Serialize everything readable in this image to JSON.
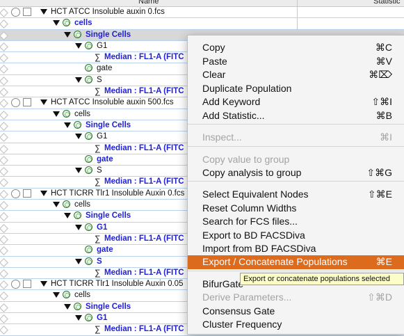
{
  "header": {
    "name": "Name",
    "statistic": "Statistic"
  },
  "rows": [
    {
      "label": "HCT ATCC Insoluble auxin 0.fcs",
      "kind": "sample"
    },
    {
      "label": "cells",
      "kind": "gate",
      "style": "blue"
    },
    {
      "label": "Single Cells",
      "kind": "gate",
      "style": "blue"
    },
    {
      "label": "G1",
      "kind": "gate"
    },
    {
      "label": "Median : FL1-A (FITC",
      "kind": "stat",
      "style": "blue"
    },
    {
      "label": "gate",
      "kind": "gate"
    },
    {
      "label": "S",
      "kind": "gate"
    },
    {
      "label": "Median : FL1-A (FITC",
      "kind": "stat",
      "style": "blue"
    },
    {
      "label": "HCT ATCC Insoluble auxin 500.fcs",
      "kind": "sample"
    },
    {
      "label": "cells",
      "kind": "gate"
    },
    {
      "label": "Single Cells",
      "kind": "gate",
      "style": "blue"
    },
    {
      "label": "G1",
      "kind": "gate"
    },
    {
      "label": "Median : FL1-A (FITC",
      "kind": "stat",
      "style": "blue"
    },
    {
      "label": "gate",
      "kind": "gate",
      "style": "blue"
    },
    {
      "label": "S",
      "kind": "gate"
    },
    {
      "label": "Median : FL1-A (FITC",
      "kind": "stat",
      "style": "blue"
    },
    {
      "label": "HCT TICRR Tlr1 Insoluble Auxin 0.fcs",
      "kind": "sample"
    },
    {
      "label": "cells",
      "kind": "gate"
    },
    {
      "label": "Single Cells",
      "kind": "gate",
      "style": "blue"
    },
    {
      "label": "G1",
      "kind": "gate",
      "style": "blue"
    },
    {
      "label": "Median : FL1-A (FITC",
      "kind": "stat",
      "style": "blue"
    },
    {
      "label": "gate",
      "kind": "gate",
      "style": "blue"
    },
    {
      "label": "S",
      "kind": "gate",
      "style": "blue"
    },
    {
      "label": "Median : FL1-A (FITC",
      "kind": "stat",
      "style": "blue"
    },
    {
      "label": "HCT TICRR Tlr1 Insoluble Auxin 0.05",
      "kind": "sample"
    },
    {
      "label": "cells",
      "kind": "gate"
    },
    {
      "label": "Single Cells",
      "kind": "gate",
      "style": "blue"
    },
    {
      "label": "G1",
      "kind": "gate",
      "style": "blue"
    },
    {
      "label": "Median : FL1-A (FITC",
      "kind": "stat",
      "style": "blue"
    }
  ],
  "context_menu": {
    "items": [
      {
        "label": "Copy",
        "shortcut": "⌘C"
      },
      {
        "label": "Paste",
        "shortcut": "⌘V"
      },
      {
        "label": "Clear",
        "shortcut": "⌘⌦"
      },
      {
        "label": "Duplicate Population",
        "shortcut": ""
      },
      {
        "label": "Add Keyword",
        "shortcut": "⇧⌘I"
      },
      {
        "label": "Add Statistic...",
        "shortcut": "⌘B"
      },
      {
        "label": "Inspect...",
        "shortcut": "⌘I",
        "disabled": true
      },
      {
        "label": "Copy value to group",
        "shortcut": "",
        "disabled": true
      },
      {
        "label": "Copy analysis to group",
        "shortcut": "⇧⌘G"
      },
      {
        "label": "Select Equivalent Nodes",
        "shortcut": "⇧⌘E"
      },
      {
        "label": "Reset Column Widths",
        "shortcut": ""
      },
      {
        "label": "Search for FCS files...",
        "shortcut": ""
      },
      {
        "label": "Export to BD FACSDiva",
        "shortcut": ""
      },
      {
        "label": "Import from BD FACSDiva",
        "shortcut": ""
      },
      {
        "label": "Export / Concatenate Populations",
        "shortcut": "⌘E",
        "highlighted": true
      },
      {
        "label": "BifurGate",
        "shortcut": ""
      },
      {
        "label": "Derive Parameters...",
        "shortcut": "⇧⌘D",
        "disabled": true
      },
      {
        "label": "Consensus Gate",
        "shortcut": ""
      },
      {
        "label": "Cluster Frequency",
        "shortcut": ""
      }
    ]
  },
  "tooltip": "Export or concatenate populations selected"
}
